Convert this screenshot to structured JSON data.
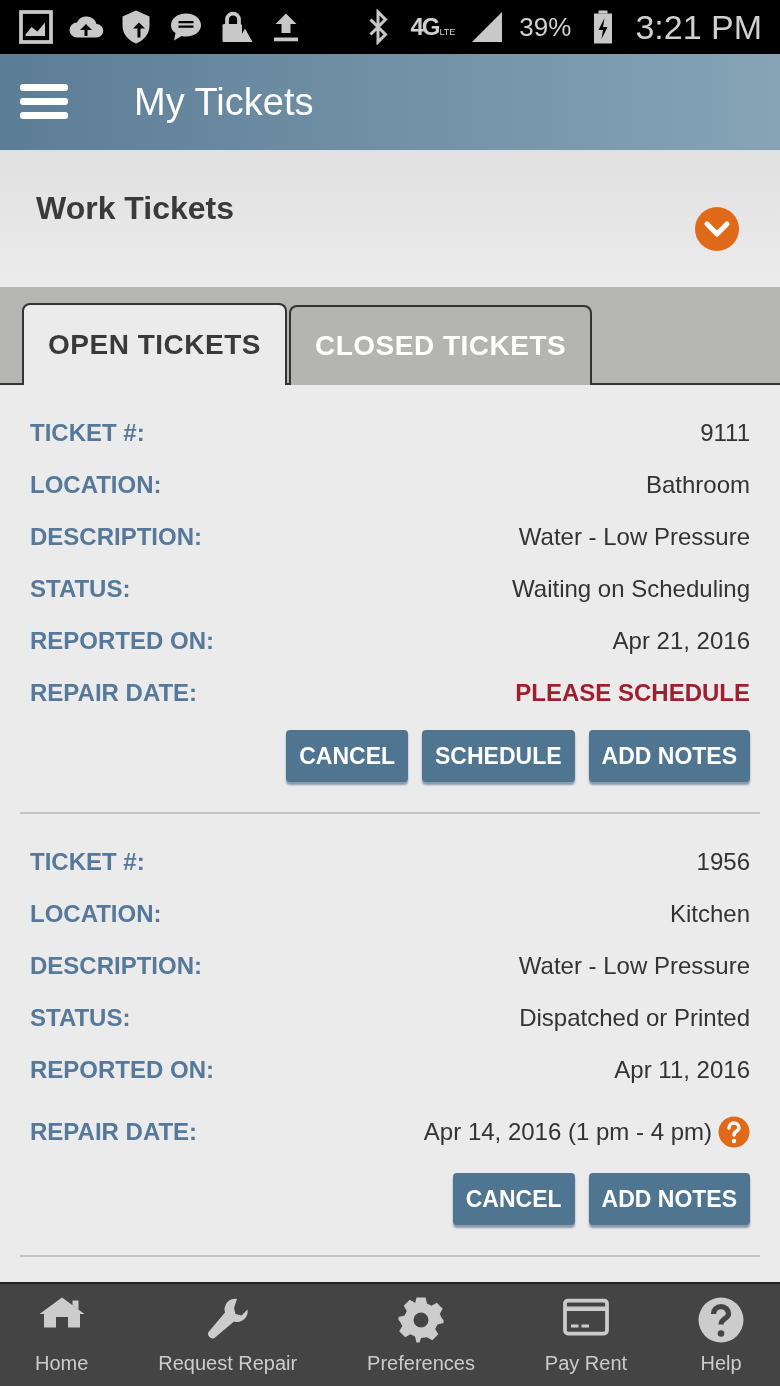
{
  "status_bar": {
    "network_type": "4G",
    "network_sub": "LTE",
    "battery": "39%",
    "time": "3:21 PM"
  },
  "app_bar": {
    "title": "My Tickets"
  },
  "section": {
    "title": "Work Tickets",
    "expanded": false
  },
  "tabs": [
    {
      "label": "OPEN TICKETS",
      "selected": true
    },
    {
      "label": "CLOSED TICKETS",
      "selected": false
    }
  ],
  "tickets": [
    {
      "fields": [
        {
          "label": "TICKET #:",
          "value": "9111",
          "kind": "text"
        },
        {
          "label": "LOCATION:",
          "value": "Bathroom",
          "kind": "text"
        },
        {
          "label": "DESCRIPTION:",
          "value": "Water - Low Pressure",
          "kind": "text"
        },
        {
          "label": "STATUS:",
          "value": "Waiting on Scheduling",
          "kind": "text"
        },
        {
          "label": "REPORTED ON:",
          "value": "Apr 21, 2016",
          "kind": "text"
        },
        {
          "label": "REPAIR DATE:",
          "value": "PLEASE SCHEDULE",
          "kind": "alert"
        }
      ],
      "buttons": [
        "CANCEL",
        "SCHEDULE",
        "ADD NOTES"
      ]
    },
    {
      "fields": [
        {
          "label": "TICKET #:",
          "value": "1956",
          "kind": "text"
        },
        {
          "label": "LOCATION:",
          "value": "Kitchen",
          "kind": "text"
        },
        {
          "label": "DESCRIPTION:",
          "value": "Water - Low Pressure",
          "kind": "text"
        },
        {
          "label": "STATUS:",
          "value": "Dispatched or Printed",
          "kind": "text"
        },
        {
          "label": "REPORTED ON:",
          "value": "Apr 11, 2016",
          "kind": "text"
        },
        {
          "label": "REPAIR DATE:",
          "value": "Apr 14, 2016 (1 pm - 4 pm)",
          "kind": "help"
        }
      ],
      "buttons": [
        "CANCEL",
        "ADD NOTES"
      ]
    }
  ],
  "bottom_nav": [
    {
      "label": "Home",
      "kind": "home"
    },
    {
      "label": "Request Repair",
      "kind": "wrench"
    },
    {
      "label": "Preferences",
      "kind": "gear"
    },
    {
      "label": "Pay Rent",
      "kind": "card"
    },
    {
      "label": "Help",
      "kind": "help"
    }
  ]
}
